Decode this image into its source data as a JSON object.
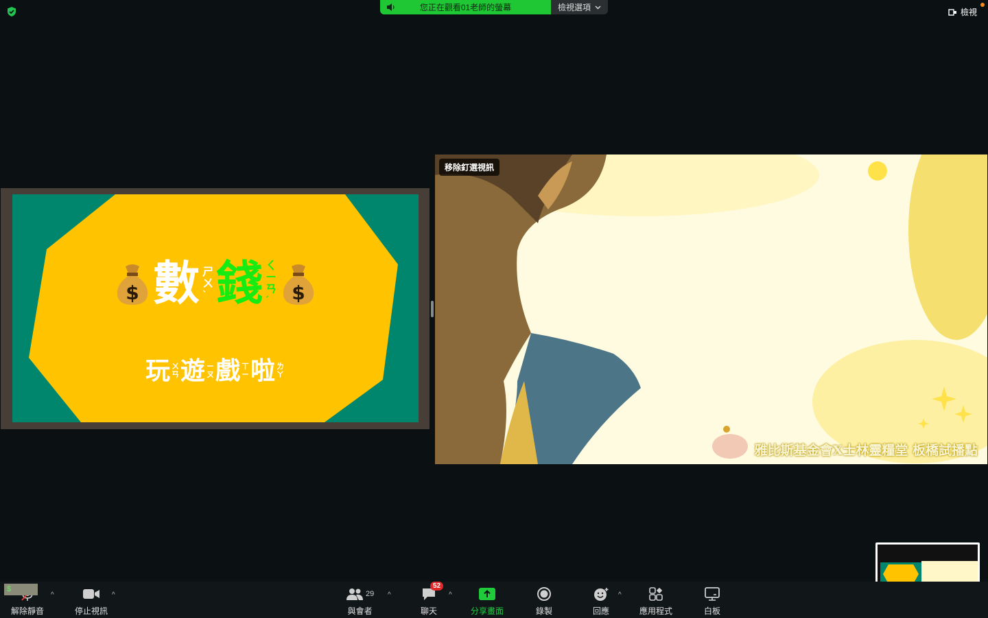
{
  "banner": {
    "viewing_text": "您正在觀看01老師的螢幕",
    "view_options_label": "檢視選項"
  },
  "top_right": {
    "view_label": "檢視"
  },
  "slide": {
    "title_left_char": "數",
    "title_left_zhuyin": [
      "ㄕ",
      "ㄨ",
      "ˋ"
    ],
    "title_right_char": "錢",
    "title_right_zhuyin": [
      "ㄑ",
      "ㄧ",
      "ㄢ",
      "ˊ"
    ],
    "subtitle": [
      {
        "char": "玩",
        "zhuyin": [
          "ㄨ",
          "ㄢ",
          "ˊ"
        ]
      },
      {
        "char": "遊",
        "zhuyin": [
          "ㄧ",
          "ㄡ",
          "ˊ"
        ]
      },
      {
        "char": "戲",
        "zhuyin": [
          "ㄒ",
          "ㄧ",
          "ˋ"
        ]
      },
      {
        "char": "啦",
        "zhuyin": [
          "ㄌ",
          "ㄚ",
          "˙"
        ]
      }
    ],
    "colors": {
      "background": "#00866d",
      "shape": "#ffc300",
      "accent": "#16ec12"
    }
  },
  "video": {
    "pin_label": "移除釘選視訊",
    "watermark": "雅比斯基金會X士林靈糧堂 板橋試播點"
  },
  "mini_tile_text": "$",
  "toolbar": {
    "unmute": "解除靜音",
    "stop_video": "停止視訊",
    "participants": "與會者",
    "participant_count": "29",
    "chat": "聊天",
    "chat_badge": "52",
    "share_screen": "分享畫面",
    "record": "錄製",
    "reactions": "回應",
    "apps": "應用程式",
    "whiteboard": "白板"
  }
}
